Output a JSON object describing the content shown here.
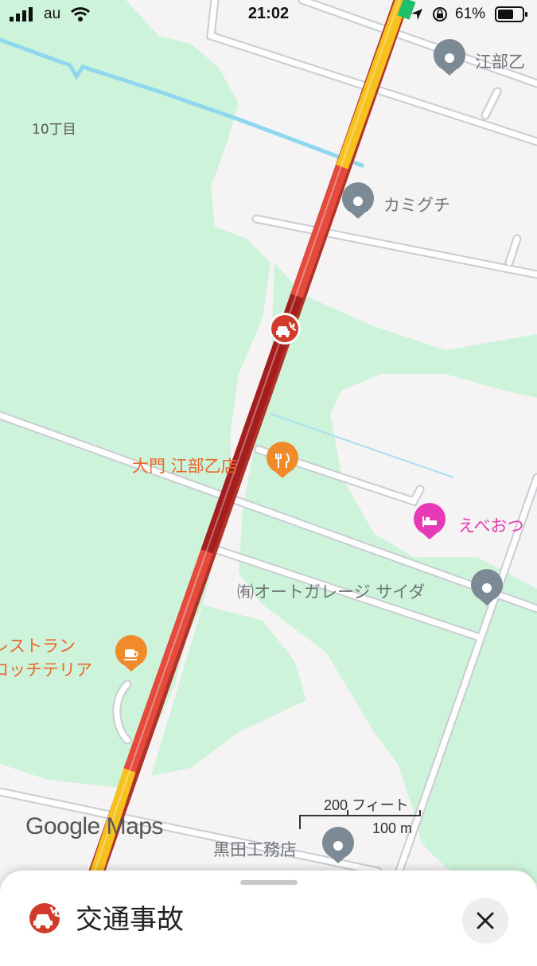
{
  "status_bar": {
    "carrier": "au",
    "time": "21:02",
    "battery": "61%"
  },
  "map": {
    "area_label": "10丁目",
    "places": [
      {
        "name": "江部乙",
        "icon": "place-marker"
      },
      {
        "name": "カミグチ",
        "icon": "place-marker"
      },
      {
        "name": "大門 江部乙店",
        "icon": "restaurant-icon"
      },
      {
        "name": "えべおつ",
        "icon": "hotel-icon"
      },
      {
        "name": "㈲オートガレージ サイダ",
        "icon": "place-marker"
      },
      {
        "name": "レストラン",
        "icon": "cafe-icon"
      },
      {
        "name": "ロッチテリア",
        "icon": "cafe-icon"
      },
      {
        "name": "黒田工務店",
        "icon": "place-marker"
      }
    ],
    "scale_imperial": "200 フィート",
    "scale_metric": "100 m",
    "logo": "Google Maps",
    "incident_icon": "car-crash-icon",
    "colors": {
      "traffic_heavy": "#e54b3c",
      "traffic_severe": "#a51e1e",
      "traffic_moderate": "#f7c11e",
      "traffic_free": "#1ec06b",
      "park": "#cdf4da",
      "water": "#8fd7ee"
    }
  },
  "sheet": {
    "title": "交通事故",
    "icon": "car-crash-icon",
    "close": "close-icon"
  }
}
